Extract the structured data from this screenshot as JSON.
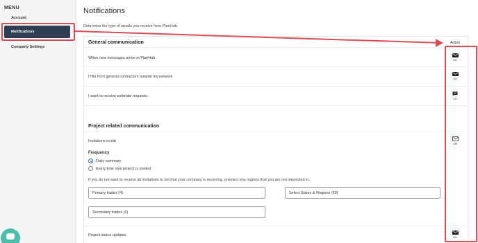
{
  "sidebar": {
    "menu_title": "MENU",
    "items": [
      {
        "label": "Account"
      },
      {
        "label": "Notifications"
      },
      {
        "label": "Company Settings"
      }
    ]
  },
  "header": {
    "title": "Notifications",
    "description": "Determine the type of emails you receive from PlanHub."
  },
  "table": {
    "action_header": "Action",
    "sections": [
      {
        "title": "General communication",
        "rows": [
          {
            "label": "When new messages arrive in PlanHub",
            "icon": "mail-icon",
            "status": "On"
          },
          {
            "label": "ITBs from general contractors outside my network",
            "icon": "mail-icon",
            "status": "On"
          },
          {
            "label": "I want to receive estimate requests",
            "icon": "chat-icon",
            "status": "On"
          }
        ]
      },
      {
        "title": "Project related communication",
        "rows": [
          {
            "label": "Invitations to bid",
            "icon": "mail-outline-icon",
            "status": "Off"
          },
          {
            "label": "Project status updates",
            "icon": "mail-icon",
            "status": "On"
          }
        ]
      }
    ]
  },
  "frequency": {
    "label": "Frequency",
    "options": [
      {
        "label": "Daily summary",
        "checked": true
      },
      {
        "label": "Every time new project is posted",
        "checked": false
      }
    ],
    "info": "If you do not want to receive all invitations to bid that your company is receiving, unselect any regions that you are not interested in."
  },
  "selects": {
    "primary_trades": "Primary trades (4)",
    "states_regions": "Select States & Regions (60)",
    "secondary_trades": "Secondary trades (0)"
  },
  "colors": {
    "sidebar_active": "#2f3e53",
    "annotation_red": "#e04a55",
    "radio_accent": "#2c6b9a",
    "chat_button": "#4bbfa9"
  }
}
